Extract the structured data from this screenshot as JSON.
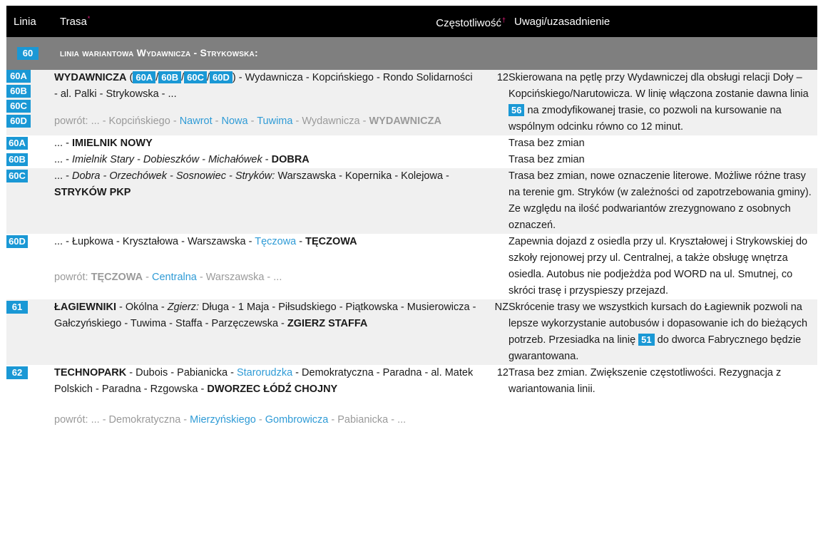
{
  "header": {
    "linia": "Linia",
    "trasa": "Trasa",
    "trasa_mark": "*",
    "czestotliwosc": "Częstotliwość",
    "czestotliwosc_mark": "†",
    "uwagi": "Uwagi/uzasadnienie"
  },
  "group": {
    "badge": "60",
    "title": "linia wariantowa Wydawnicza - Strykowska:"
  },
  "colors": {
    "badge": "#1a98d5",
    "header_bg": "#000000",
    "group_bg": "#7f7f7f",
    "row_shade": "#f0f0f0",
    "link_blue": "#2f9bd6",
    "return_gray": "#9a9a9a",
    "marker_pink": "#e8197d"
  },
  "rows": {
    "r60": {
      "badges": [
        "60A",
        "60B",
        "60C",
        "60D"
      ],
      "route": {
        "start": "WYDAWNICZA",
        "open_paren": " (",
        "b1": "60A",
        "sep1": "/",
        "b2": "60B",
        "sep2": "/",
        "b3": "60C",
        "sep3": "/",
        "b4": "60D",
        "rest": ") - Wydawnicza - Kopcińskiego - Rondo Solidarności - al. Palki - Strykowska - ..."
      },
      "ret": {
        "prefix": "powrót: ... - Kopcińskiego - ",
        "s1": "Nawrot",
        "d1": " - ",
        "s2": "Nowa",
        "d2": " - ",
        "s3": "Tuwima",
        "suffix": " - Wydawnicza - ",
        "end": "WYDAWNICZA"
      },
      "freq": "12",
      "note": {
        "a": "Skierowana na pętlę przy Wydawniczej dla obsługi relacji Doły – Kopcińskiego/Narutowicza. W linię włączona zostanie dawna linia ",
        "badge": "56",
        "b": " na zmodyfikowanej trasie, co pozwoli na kursowanie na wspólnym odcinku równo co 12 minut."
      }
    },
    "r60a": {
      "badge": "60A",
      "prefix": "... - ",
      "end": "IMIELNIK NOWY",
      "note": "Trasa bez zmian"
    },
    "r60b": {
      "badge": "60B",
      "prefix": "... - ",
      "italic": "Imielnik Stary - Dobieszków - Michałówek",
      "dash": " - ",
      "end": "DOBRA",
      "note": "Trasa bez zmian"
    },
    "r60c": {
      "badge": "60C",
      "prefix": "... - ",
      "italic": "Dobra - Orzechówek - Sosnowiec - Stryków:",
      "mid": " Warszawska - Kopernika - Kolejowa - ",
      "end": "STRYKÓW PKP",
      "note": "Trasa bez zmian, nowe oznaczenie literowe. Możliwe różne trasy na terenie gm. Stryków (w zależności od zapotrzebowania gminy). Ze względu na ilość podwariantów zrezygnowano z osobnych oznaczeń."
    },
    "r60d": {
      "badge": "60D",
      "prefix": "... - Łupkowa - Kryształowa - Warszawska - ",
      "blue": "Tęczowa",
      "dash": " - ",
      "end": "TĘCZOWA",
      "ret": {
        "prefix": "powrót: ",
        "start": "TĘCZOWA",
        "d1": " - ",
        "blue": "Centralna",
        "suffix": " - Warszawska - ..."
      },
      "note": "Zapewnia dojazd z osiedla przy ul. Kryształowej i Strykowskiej do szkoły rejonowej przy ul. Centralnej, a także obsługę wnętrza osiedla. Autobus nie podjeżdża pod WORD na ul. Smutnej, co skróci trasę i przyspieszy przejazd."
    },
    "r61": {
      "badge": "61",
      "start": "ŁAGIEWNIKI",
      "d1": " - Okólna - ",
      "italic": "Zgierz:",
      "mid": " Długa - 1 Maja - Piłsudskiego - Piątkowska - Musierowicza - Gałczyńskiego - Tuwima - Staffa - Parzęczewska - ",
      "end": "ZGIERZ STAFFA",
      "freq": "NZ",
      "note": {
        "a": "Skrócenie trasy we wszystkich kursach do Łagiewnik pozwoli na lepsze wykorzystanie autobusów i dopasowanie ich do bieżących potrzeb. Przesiadka na linię ",
        "badge": "51",
        "b": " do dworca Fabrycznego będzie gwarantowana."
      }
    },
    "r62": {
      "badge": "62",
      "start": "TECHNOPARK",
      "d1": " - Dubois - Pabianicka - ",
      "blue": "Starorudzka",
      "mid": " - Demokratyczna - Paradna - al. Matek Polskich - Paradna - Rzgowska - ",
      "end": "DWORZEC ŁÓDŹ CHOJNY",
      "ret": {
        "prefix": "powrót: ... - Demokratyczna - ",
        "s1": "Mierzyńskiego",
        "d1": " - ",
        "s2": "Gombrowicza",
        "suffix": " - Pabianicka - ..."
      },
      "freq": "12",
      "note": "Trasa bez zmian. Zwiększenie częstotliwości. Rezygnacja z wariantowania linii."
    }
  }
}
